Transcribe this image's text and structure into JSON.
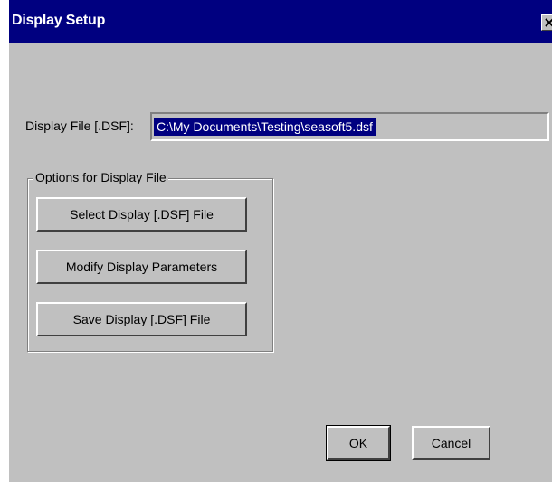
{
  "window": {
    "title": "Display Setup",
    "title_bar_color": "#000080",
    "face_color": "#c0c0c0"
  },
  "display_file": {
    "label": "Display File [.DSF]:",
    "value": "C:\\My Documents\\Testing\\seasoft5.dsf"
  },
  "options_group": {
    "label": "Options for Display File",
    "buttons": [
      {
        "label": "Select Display [.DSF] File"
      },
      {
        "label": "Modify Display Parameters"
      },
      {
        "label": "Save Display [.DSF] File"
      }
    ]
  },
  "footer": {
    "ok_label": "OK",
    "cancel_label": "Cancel"
  },
  "icons": {
    "close": "close-icon"
  }
}
